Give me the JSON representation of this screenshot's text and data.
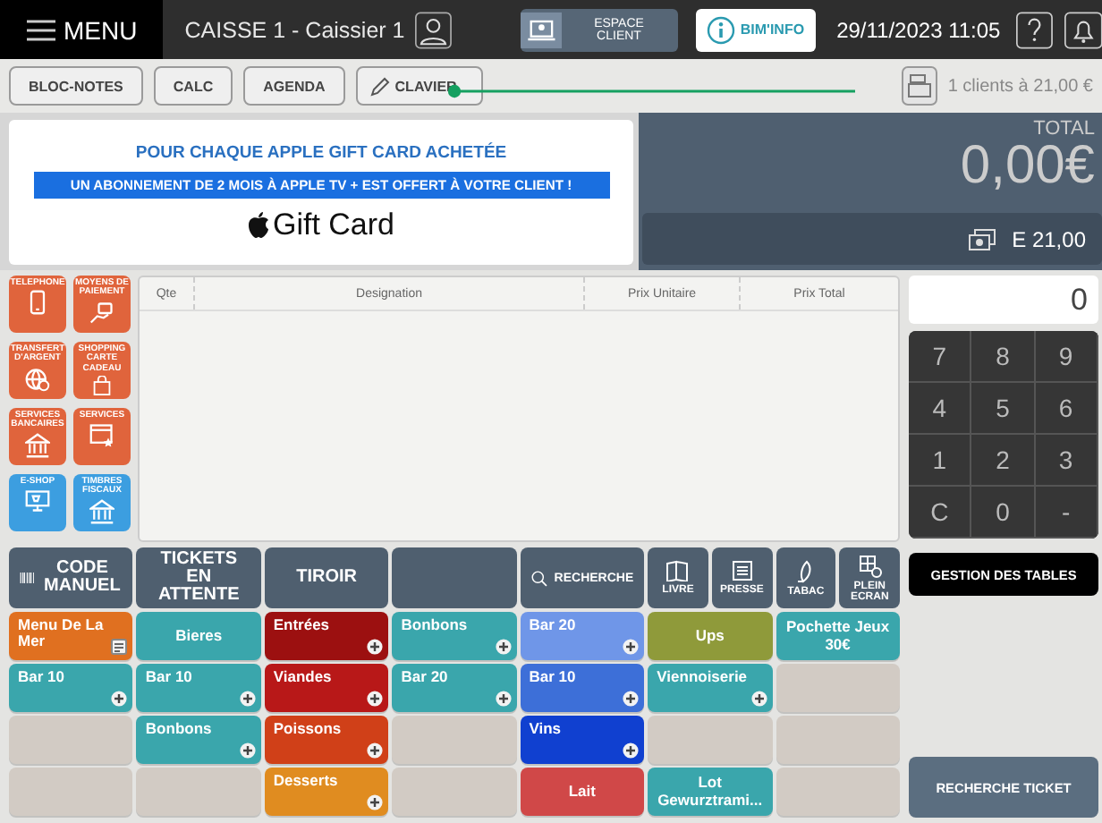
{
  "top_bar": {
    "menu_label": "MENU",
    "register": "CAISSE 1 - Caissier 1",
    "client_button": "ESPACE CLIENT",
    "info_button": "BIM'INFO",
    "datetime": "29/11/2023 11:05"
  },
  "toolbar": {
    "buttons": [
      "BLOC-NOTES",
      "CALC",
      "AGENDA",
      "CLAVIER"
    ],
    "clients": "1 clients à 21,00 €"
  },
  "promo": {
    "headline": "POUR CHAQUE APPLE GIFT CARD ACHETÉE",
    "offer": "UN ABONNEMENT DE 2 MOIS À APPLE TV + EST OFFERT À VOTRE CLIENT !",
    "product": "Gift Card"
  },
  "total": {
    "label": "TOTAL",
    "amount": "0,00€",
    "payment": "E 21,00"
  },
  "categories": [
    {
      "label": "TELEPHONE",
      "color": "#e0643c"
    },
    {
      "label": "MOYENS DE PAIEMENT",
      "color": "#e0643c"
    },
    {
      "label": "TRANSFERT D'ARGENT",
      "color": "#e0643c"
    },
    {
      "label": "SHOPPING CARTE CADEAU",
      "color": "#e0643c"
    },
    {
      "label": "SERVICES BANCAIRES",
      "color": "#e0643c"
    },
    {
      "label": "SERVICES",
      "color": "#e0643c"
    },
    {
      "label": "E-SHOP",
      "color": "#3c9ee0"
    },
    {
      "label": "TIMBRES FISCAUX",
      "color": "#3c9ee0"
    }
  ],
  "ticket": {
    "columns": [
      "Qte",
      "Designation",
      "Prix Unitaire",
      "Prix Total"
    ]
  },
  "keypad": {
    "display": "0",
    "keys": [
      "7",
      "8",
      "9",
      "4",
      "5",
      "6",
      "1",
      "2",
      "3",
      "C",
      "0",
      "-"
    ],
    "tables_button": "GESTION DES TABLES",
    "search_button": "RECHERCHE TICKET"
  },
  "actions": [
    {
      "kind": "wide",
      "label": "CODE MANUEL"
    },
    {
      "kind": "wide",
      "label": "TICKETS EN ATTENTE"
    },
    {
      "kind": "wide",
      "label": "TIROIR"
    },
    {
      "kind": "wide"
    },
    {
      "kind": "wide",
      "label": "RECHERCHE"
    },
    {
      "kind": "narrow",
      "label": "LIVRE"
    },
    {
      "kind": "narrow",
      "label": "PRESSE"
    },
    {
      "kind": "narrow",
      "label": "TABAC"
    },
    {
      "kind": "narrow",
      "label": "PLEIN ECRAN"
    }
  ],
  "tiles": [
    {
      "kind": "menu",
      "label": "Menu De La Mer",
      "color": "#e07020"
    },
    {
      "kind": "plain",
      "label": "Bieres",
      "color": "#3aa6ac"
    },
    {
      "kind": "plus",
      "label": "Entrées",
      "color": "#9c1010"
    },
    {
      "kind": "plus",
      "label": "Bonbons",
      "color": "#3aa6ac"
    },
    {
      "kind": "plus",
      "label": "Bar 20",
      "color": "#6f96e8"
    },
    {
      "kind": "plain",
      "label": "Ups",
      "color": "#8f9a3a"
    },
    {
      "kind": "plain",
      "label": "Pochette Jeux 30€",
      "color": "#3aa6ac"
    },
    {
      "kind": "plus",
      "label": "Bar 10",
      "color": "#3aa6ac"
    },
    {
      "kind": "plus",
      "label": "Bar 10",
      "color": "#3aa6ac"
    },
    {
      "kind": "plus",
      "label": "Viandes",
      "color": "#b81818"
    },
    {
      "kind": "plus",
      "label": "Bar 20",
      "color": "#3aa6ac"
    },
    {
      "kind": "plus",
      "label": "Bar 10",
      "color": "#3d6fd8"
    },
    {
      "kind": "plus",
      "label": "Viennoiserie",
      "color": "#3aa6ac"
    },
    {
      "kind": "empty"
    },
    {
      "kind": "empty"
    },
    {
      "kind": "plus",
      "label": "Bonbons",
      "color": "#3aa6ac"
    },
    {
      "kind": "plus",
      "label": "Poissons",
      "color": "#d04018"
    },
    {
      "kind": "empty"
    },
    {
      "kind": "plus",
      "label": "Vins",
      "color": "#1040d0"
    },
    {
      "kind": "empty"
    },
    {
      "kind": "empty"
    },
    {
      "kind": "empty"
    },
    {
      "kind": "empty"
    },
    {
      "kind": "plus",
      "label": "Desserts",
      "color": "#e08c20"
    },
    {
      "kind": "empty"
    },
    {
      "kind": "plain",
      "label": "Lait",
      "color": "#d04848"
    },
    {
      "kind": "plain",
      "label": "Lot Gewurztrami...",
      "color": "#3aa6ac"
    },
    {
      "kind": "empty"
    }
  ]
}
